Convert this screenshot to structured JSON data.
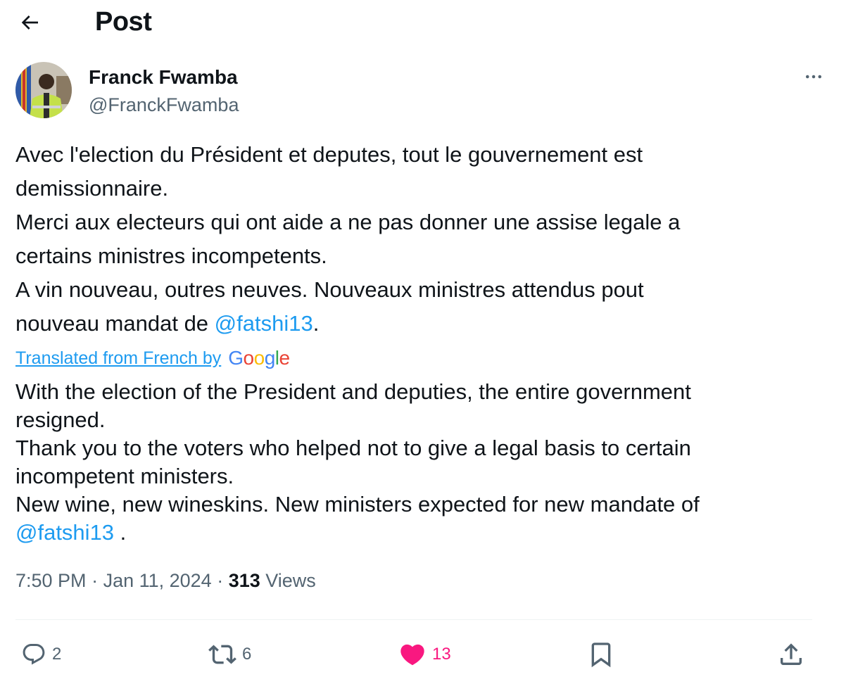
{
  "header": {
    "title": "Post",
    "back_icon": "arrow-left-icon"
  },
  "author": {
    "name": "Franck Fwamba",
    "handle": "@FranckFwamba",
    "avatar_icon": "profile-photo",
    "more_icon": "more-horizontal-icon"
  },
  "tweet": {
    "original_lines": [
      "Avec l'election du Président et deputes, tout le gouvernement est",
      "demissionnaire.",
      "Merci aux electeurs qui ont aide a ne pas donner une assise legale a",
      "certains ministres incompetents.",
      "A vin nouveau, outres neuves. Nouveaux ministres attendus pout"
    ],
    "original_last_prefix": "nouveau mandat de ",
    "original_mention": "@fatshi13",
    "original_last_suffix": ".",
    "translated_label": "Translated from French by",
    "google_letters": [
      "G",
      "o",
      "o",
      "g",
      "l",
      "e"
    ],
    "translation_lines": [
      "With the election of the President and deputies, the entire government",
      "resigned.",
      "Thank you to the voters who helped not to give a legal basis to certain",
      "incompetent ministers.",
      "New wine, new wineskins. New ministers expected for new mandate of"
    ],
    "translation_mention": "@fatshi13",
    "translation_suffix": " ."
  },
  "meta": {
    "time": "7:50 PM",
    "separator": " · ",
    "date": "Jan 11, 2024",
    "views_count": "313",
    "views_label": " Views"
  },
  "actions": {
    "replies": "2",
    "reposts": "6",
    "likes": "13"
  },
  "colors": {
    "accent": "#1d9bf0",
    "like": "#f91880",
    "secondary_text": "#536471",
    "google_blue": "#4285F4",
    "google_red": "#EA4335",
    "google_yellow": "#FBBC05",
    "google_green": "#34A853"
  }
}
